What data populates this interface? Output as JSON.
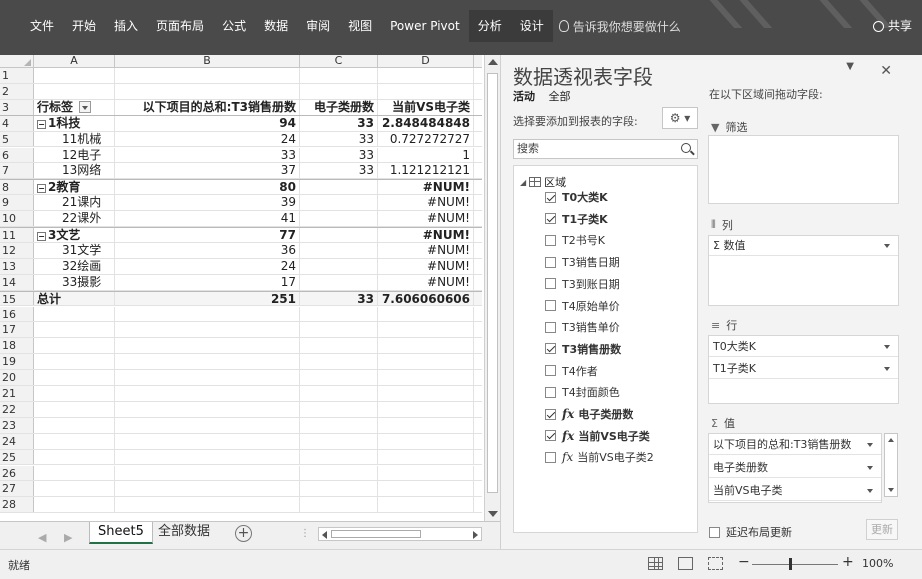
{
  "ribbon": {
    "tabs": [
      "文件",
      "开始",
      "插入",
      "页面布局",
      "公式",
      "数据",
      "审阅",
      "视图",
      "Power Pivot",
      "分析",
      "设计"
    ],
    "tell_me": "告诉我你想要做什么",
    "share": "共享"
  },
  "sheet": {
    "columns": [
      "A",
      "B",
      "C",
      "D"
    ],
    "row_numbers": [
      "1",
      "2",
      "3",
      "4",
      "5",
      "6",
      "7",
      "8",
      "9",
      "10",
      "11",
      "12",
      "13",
      "14",
      "15",
      "16",
      "17",
      "18",
      "19",
      "20",
      "21",
      "22",
      "23",
      "24",
      "25",
      "26",
      "27",
      "28"
    ],
    "headers": {
      "row_label": "行标签",
      "sum_col": "以下项目的总和:T3销售册数",
      "ebook_col": "电子类册数",
      "vs_col": "当前VS电子类"
    },
    "rows": [
      {
        "label": "1科技",
        "sum": "94",
        "ebook": "33",
        "vs": "2.848484848"
      },
      {
        "label": "11机械",
        "sum": "24",
        "ebook": "33",
        "vs": "0.727272727"
      },
      {
        "label": "12电子",
        "sum": "33",
        "ebook": "33",
        "vs": "1"
      },
      {
        "label": "13网络",
        "sum": "37",
        "ebook": "33",
        "vs": "1.121212121"
      },
      {
        "label": "2教育",
        "sum": "80",
        "ebook": "",
        "vs": "#NUM!"
      },
      {
        "label": "21课内",
        "sum": "39",
        "ebook": "",
        "vs": "#NUM!"
      },
      {
        "label": "22课外",
        "sum": "41",
        "ebook": "",
        "vs": "#NUM!"
      },
      {
        "label": "3文艺",
        "sum": "77",
        "ebook": "",
        "vs": "#NUM!"
      },
      {
        "label": "31文学",
        "sum": "36",
        "ebook": "",
        "vs": "#NUM!"
      },
      {
        "label": "32绘画",
        "sum": "24",
        "ebook": "",
        "vs": "#NUM!"
      },
      {
        "label": "33摄影",
        "sum": "17",
        "ebook": "",
        "vs": "#NUM!"
      }
    ],
    "total": {
      "label": "总计",
      "sum": "251",
      "ebook": "33",
      "vs": "7.606060606"
    }
  },
  "sheet_tabs": {
    "tabs": [
      "Sheet5",
      "全部数据"
    ],
    "active": "Sheet5"
  },
  "pivot_pane": {
    "title": "数据透视表字段",
    "tabs": [
      "活动",
      "全部"
    ],
    "choose_label": "选择要添加到报表的字段:",
    "search_placeholder": "搜索",
    "table_name": "区域",
    "fields": [
      {
        "name": "T0大类K",
        "checked": true,
        "fx": false
      },
      {
        "name": "T1子类K",
        "checked": true,
        "fx": false
      },
      {
        "name": "T2书号K",
        "checked": false,
        "fx": false
      },
      {
        "name": "T3销售日期",
        "checked": false,
        "fx": false
      },
      {
        "name": "T3到账日期",
        "checked": false,
        "fx": false
      },
      {
        "name": "T4原始单价",
        "checked": false,
        "fx": false
      },
      {
        "name": "T3销售单价",
        "checked": false,
        "fx": false
      },
      {
        "name": "T3销售册数",
        "checked": true,
        "fx": false
      },
      {
        "name": "T4作者",
        "checked": false,
        "fx": false
      },
      {
        "name": "T4封面颜色",
        "checked": false,
        "fx": false
      },
      {
        "name": "电子类册数",
        "checked": true,
        "fx": true
      },
      {
        "name": "当前VS电子类",
        "checked": true,
        "fx": true
      },
      {
        "name": "当前VS电子类2",
        "checked": false,
        "fx": true
      }
    ],
    "drag_label": "在以下区域间拖动字段:",
    "filter_label": "筛选",
    "columns_label": "列",
    "columns_items": [
      "Σ 数值"
    ],
    "rows_label": "行",
    "rows_items": [
      "T0大类K",
      "T1子类K"
    ],
    "values_label": "值",
    "values_items": [
      "以下项目的总和:T3销售册数",
      "电子类册数",
      "当前VS电子类"
    ],
    "defer_label": "延迟布局更新",
    "update_label": "更新"
  },
  "status": {
    "text": "就绪",
    "zoom": "100%"
  }
}
